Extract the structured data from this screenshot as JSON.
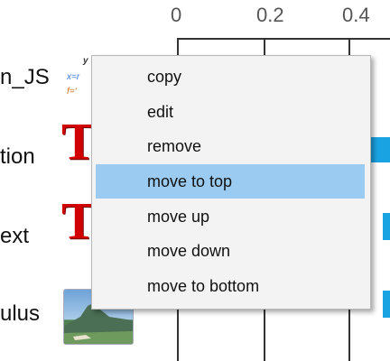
{
  "axis": {
    "ticks": [
      "0",
      "0.2",
      "0.4"
    ]
  },
  "rows": [
    {
      "label": "n_JS",
      "mini_lines": [
        "x=r",
        "f=‘"
      ],
      "mini_header": "y"
    },
    {
      "label": "tion",
      "icon": "T"
    },
    {
      "label": "ext",
      "icon": "T"
    },
    {
      "label": "ulus",
      "thumbnail": "landscape-photo"
    }
  ],
  "context_menu": {
    "items": [
      "copy",
      "edit",
      "remove",
      "move to top",
      "move up",
      "move down",
      "move to bottom"
    ],
    "active_index": 3
  },
  "colors": {
    "bar": "#1aa3e3",
    "menu_highlight": "#9ccbf2",
    "icon_red": "#d00000"
  }
}
